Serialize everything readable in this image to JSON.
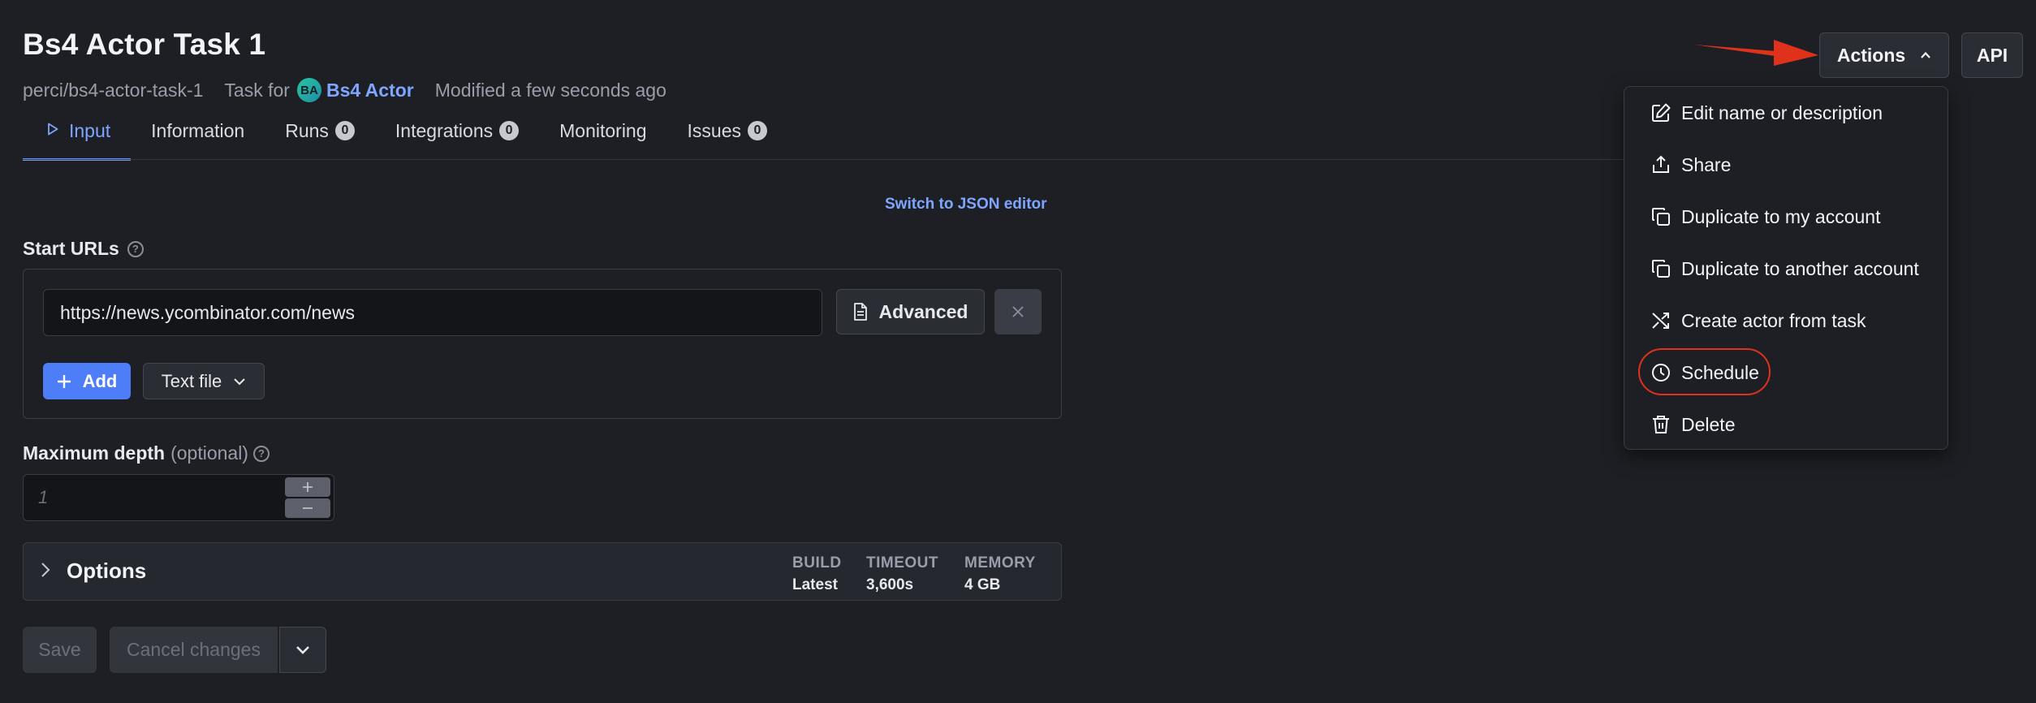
{
  "header": {
    "title": "Bs4 Actor Task 1",
    "slug": "perci/bs4-actor-task-1",
    "task_for_label": "Task for",
    "actor_initials": "BA",
    "actor_name": "Bs4 Actor",
    "modified": "Modified a few seconds ago"
  },
  "tabs": [
    {
      "label": "Input",
      "active": true
    },
    {
      "label": "Information"
    },
    {
      "label": "Runs",
      "count": "0"
    },
    {
      "label": "Integrations",
      "count": "0"
    },
    {
      "label": "Monitoring"
    },
    {
      "label": "Issues",
      "count": "0"
    }
  ],
  "input": {
    "json_editor_link": "Switch to JSON editor",
    "start_urls": {
      "label": "Start URLs",
      "help_glyph": "?",
      "url_value": "https://news.ycombinator.com/news",
      "advanced_label": "Advanced",
      "add_label": "Add",
      "text_file_label": "Text file"
    },
    "max_depth": {
      "label": "Maximum depth",
      "optional": "(optional)",
      "placeholder": "1"
    },
    "options": {
      "title": "Options",
      "build_key": "BUILD",
      "build_value": "Latest",
      "timeout_key": "TIMEOUT",
      "timeout_value": "3,600s",
      "memory_key": "MEMORY",
      "memory_value": "4 GB"
    }
  },
  "footer": {
    "save_label": "Save",
    "cancel_label": "Cancel changes"
  },
  "toolbar": {
    "actions_label": "Actions",
    "api_label": "API"
  },
  "actions_menu": {
    "items": [
      {
        "label": "Edit name or description",
        "icon": "edit-icon"
      },
      {
        "label": "Share",
        "icon": "share-icon"
      },
      {
        "label": "Duplicate to my account",
        "icon": "copy-icon"
      },
      {
        "label": "Duplicate to another account",
        "icon": "copy-icon"
      },
      {
        "label": "Create actor from task",
        "icon": "shuffle-icon"
      },
      {
        "label": "Schedule",
        "icon": "clock-icon",
        "highlighted": true
      },
      {
        "label": "Delete",
        "icon": "trash-icon"
      }
    ]
  },
  "colors": {
    "background": "#1e1f24",
    "accent": "#4d7ef7",
    "link": "#7ea6ff",
    "annotation": "#e0321b"
  }
}
